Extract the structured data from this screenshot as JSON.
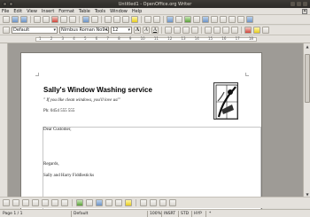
{
  "window": {
    "title": "Untitled1 - OpenOffice.org Writer"
  },
  "menubar": {
    "items": [
      "File",
      "Edit",
      "View",
      "Insert",
      "Format",
      "Table",
      "Tools",
      "Window",
      "Help"
    ],
    "close_glyph": "✕"
  },
  "formatting": {
    "style": "Default",
    "font": "Nimbus Roman No9 L",
    "size": "12",
    "bold_glyph": "A",
    "italic_glyph": "A",
    "underline_glyph": "A"
  },
  "ruler": {
    "numbers": [
      "1",
      "2",
      "3",
      "4",
      "5",
      "6",
      "7",
      "8",
      "9",
      "10",
      "11",
      "12",
      "13",
      "14",
      "15",
      "16",
      "17",
      "18"
    ]
  },
  "document": {
    "company": "Sally's Window Washing service",
    "slogan": "\" If you like clean windows, you'll love us!\"",
    "phone": "Ph: 0454 555 555",
    "salutation": "Dear Customer,",
    "closing": "Regards,",
    "signature": "Sally and Harry Fiddlesticks"
  },
  "statusbar": {
    "page": "Page 1 / 1",
    "style": "Default",
    "zoom": "100%",
    "insert": "INSRT",
    "selection": "STD",
    "hyperlink": "HYP",
    "star": "*"
  },
  "colors": {
    "highlight": "#f2e63a",
    "font_color": "#d62222"
  },
  "scrollbar": {
    "up": "▲",
    "down": "▼"
  }
}
